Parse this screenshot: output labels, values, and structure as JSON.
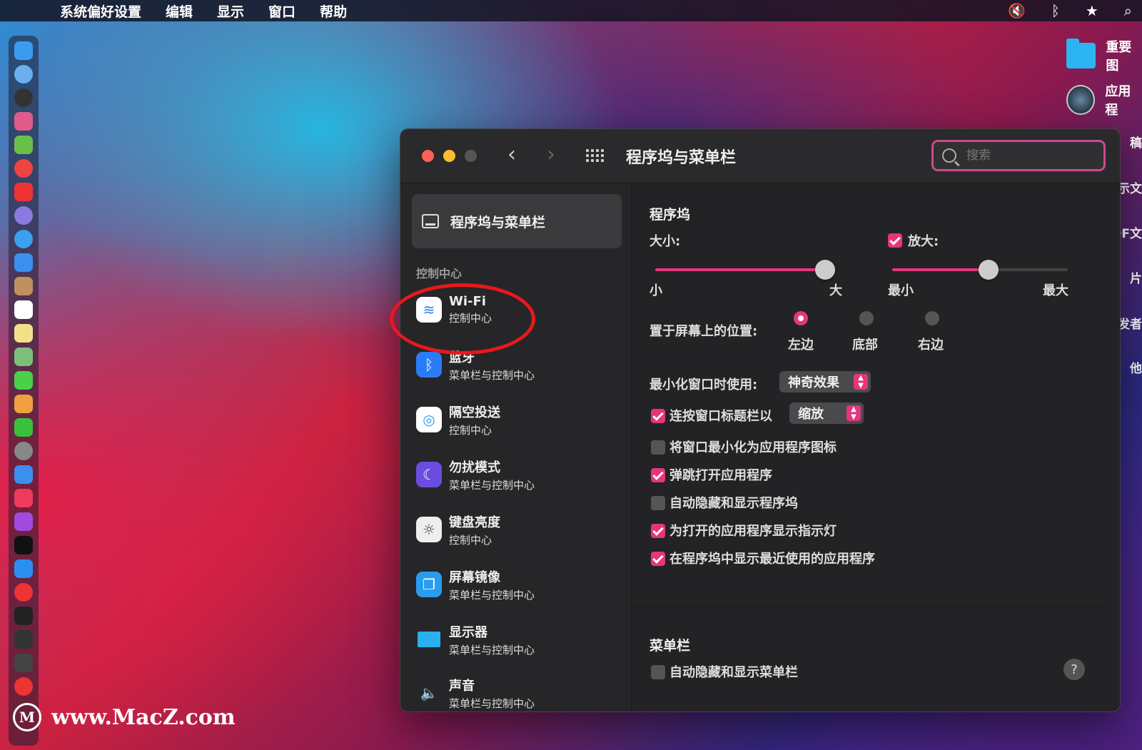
{
  "menubar": {
    "app_name": "系统偏好设置",
    "items": [
      "编辑",
      "显示",
      "窗口",
      "帮助"
    ]
  },
  "desktop": {
    "items": [
      {
        "label": "重要图",
        "icon": "folder-icon"
      },
      {
        "label": "应用程",
        "icon": "app-icon"
      }
    ],
    "edge_labels": [
      "稿",
      "示文",
      "DF文",
      "片",
      "发者",
      "他"
    ]
  },
  "window": {
    "title": "程序坞与菜单栏",
    "search_placeholder": "搜索"
  },
  "sidebar": {
    "selected": "程序坞与菜单栏",
    "section": "控制中心",
    "items": [
      {
        "title": "Wi-Fi",
        "subtitle": "控制中心",
        "icon": "wifi-icon",
        "color": "#2a7cf6"
      },
      {
        "title": "蓝牙",
        "subtitle": "菜单栏与控制中心",
        "icon": "bluetooth-icon",
        "color": "#2a7cf6"
      },
      {
        "title": "隔空投送",
        "subtitle": "控制中心",
        "icon": "airdrop-icon",
        "color": "#2a9cf0"
      },
      {
        "title": "勿扰模式",
        "subtitle": "菜单栏与控制中心",
        "icon": "moon-icon",
        "color": "#6a4de0"
      },
      {
        "title": "键盘亮度",
        "subtitle": "控制中心",
        "icon": "keyboard-brightness-icon",
        "color": "#8e8e93"
      },
      {
        "title": "屏幕镜像",
        "subtitle": "菜单栏与控制中心",
        "icon": "screen-mirroring-icon",
        "color": "#2a9cf0"
      },
      {
        "title": "显示器",
        "subtitle": "菜单栏与控制中心",
        "icon": "display-icon",
        "color": "#2a9cf0"
      },
      {
        "title": "声音",
        "subtitle": "菜单栏与控制中心",
        "icon": "speaker-icon",
        "color": "#555555"
      }
    ]
  },
  "dock_section": {
    "title": "程序坞",
    "size_label": "大小:",
    "size_min": "小",
    "size_max": "大",
    "size_value": 0.95,
    "magnify_label": "放大:",
    "magnify_checked": true,
    "magnify_min": "最小",
    "magnify_max": "最大",
    "magnify_value": 0.55,
    "position_label": "置于屏幕上的位置:",
    "positions": [
      "左边",
      "底部",
      "右边"
    ],
    "position_selected": "左边",
    "minimize_label": "最小化窗口时使用:",
    "minimize_value": "神奇效果",
    "double_click_label": "连按窗口标题栏以",
    "double_click_value": "缩放",
    "double_click_checked": true,
    "options": [
      {
        "label": "将窗口最小化为应用程序图标",
        "checked": false
      },
      {
        "label": "弹跳打开应用程序",
        "checked": true
      },
      {
        "label": "自动隐藏和显示程序坞",
        "checked": false
      },
      {
        "label": "为打开的应用程序显示指示灯",
        "checked": true
      },
      {
        "label": "在程序坞中显示最近使用的应用程序",
        "checked": true
      }
    ]
  },
  "menubar_section": {
    "title": "菜单栏",
    "autohide_label": "自动隐藏和显示菜单栏",
    "autohide_checked": false
  },
  "help_label": "?",
  "watermark": "www.MacZ.com",
  "colors": {
    "accent": "#e6357c",
    "annotation": "#e8181c"
  }
}
